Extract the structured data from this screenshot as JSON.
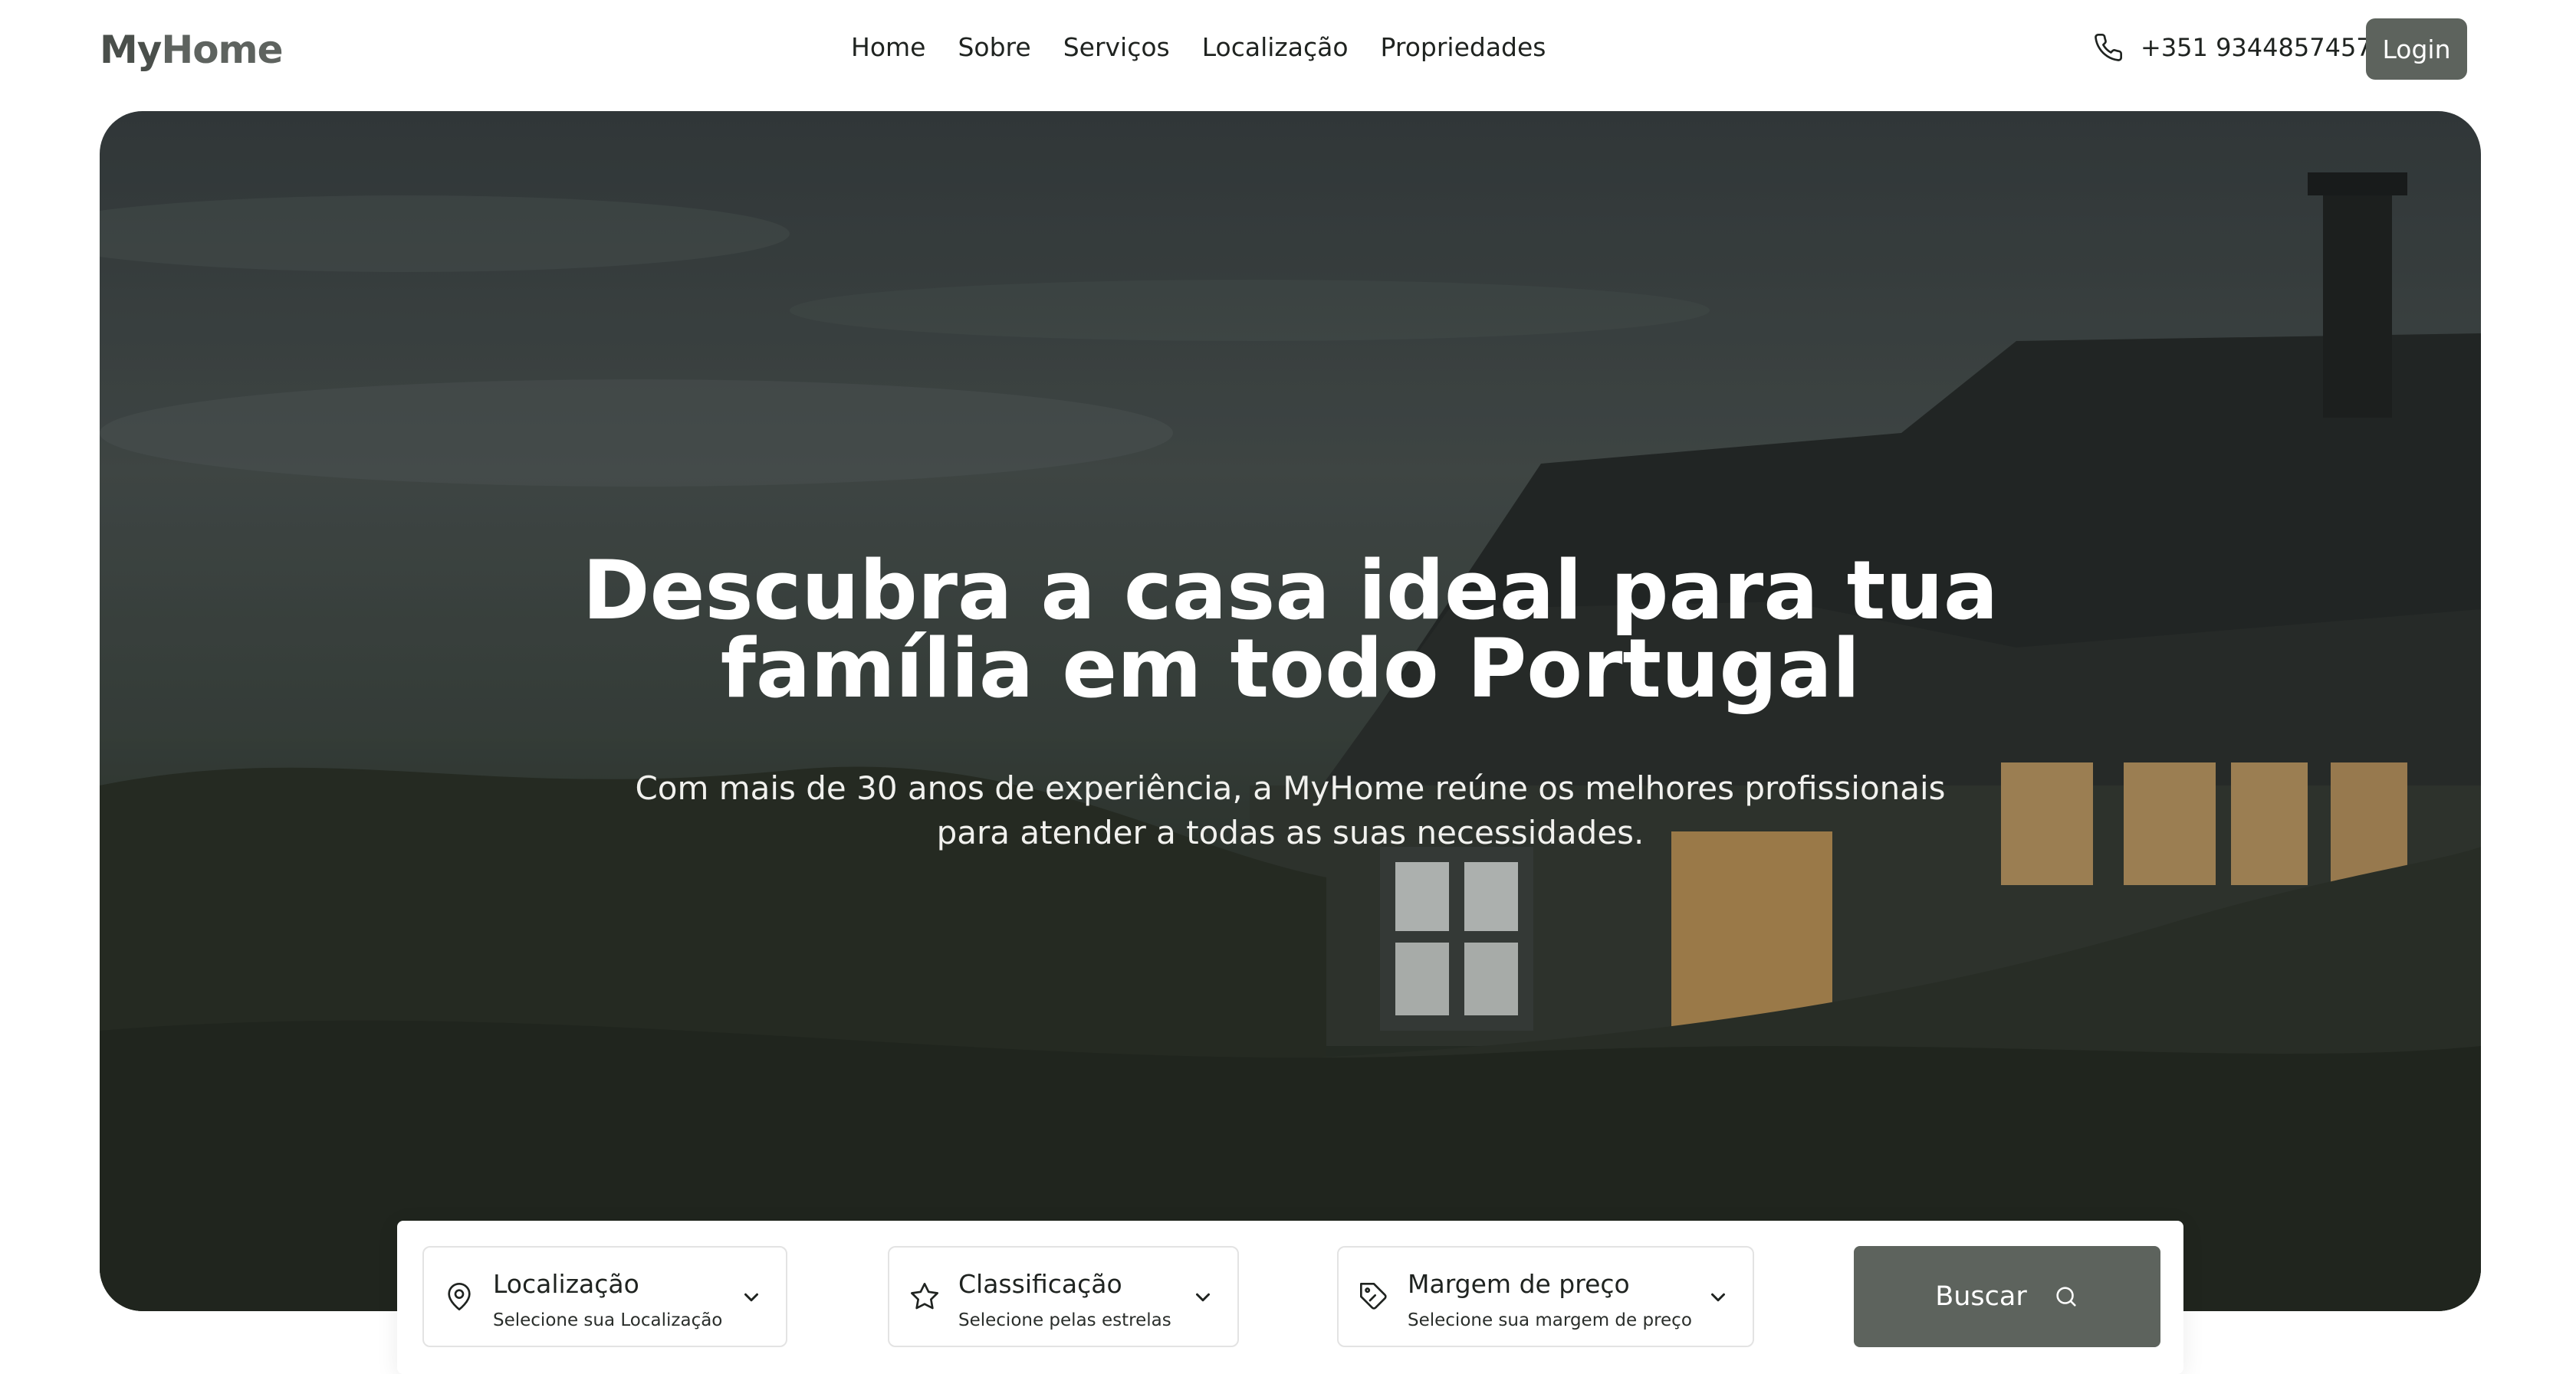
{
  "brand": {
    "logo_part1": "My",
    "logo_part2": "Home"
  },
  "nav": {
    "items": [
      "Home",
      "Sobre",
      "Serviços",
      "Localização",
      "Propriedades"
    ]
  },
  "contact": {
    "phone": "+351 9344857457",
    "icon": "phone-icon"
  },
  "header": {
    "login_label": "Login"
  },
  "hero": {
    "title_line1": "Descubra a casa ideal para tua",
    "title_line2": "família em todo Portugal",
    "subtitle_line1": "Com mais de 30 anos de experiência, a MyHome reúne os melhores profissionais",
    "subtitle_line2": "para atender a todas as suas necessidades."
  },
  "search": {
    "fields": [
      {
        "title": "Localização",
        "subtitle": "Selecione sua Localização",
        "icon": "map-pin-icon"
      },
      {
        "title": "Classificação",
        "subtitle": "Selecione pelas estrelas",
        "icon": "star-icon"
      },
      {
        "title": "Margem de preço",
        "subtitle": "Selecione sua margem de preço",
        "icon": "price-tag-icon"
      }
    ],
    "button_label": "Buscar",
    "button_icon": "search-icon"
  },
  "colors": {
    "accent": "#5d635d",
    "text": "#1f2320",
    "hero_text": "#ffffff"
  }
}
